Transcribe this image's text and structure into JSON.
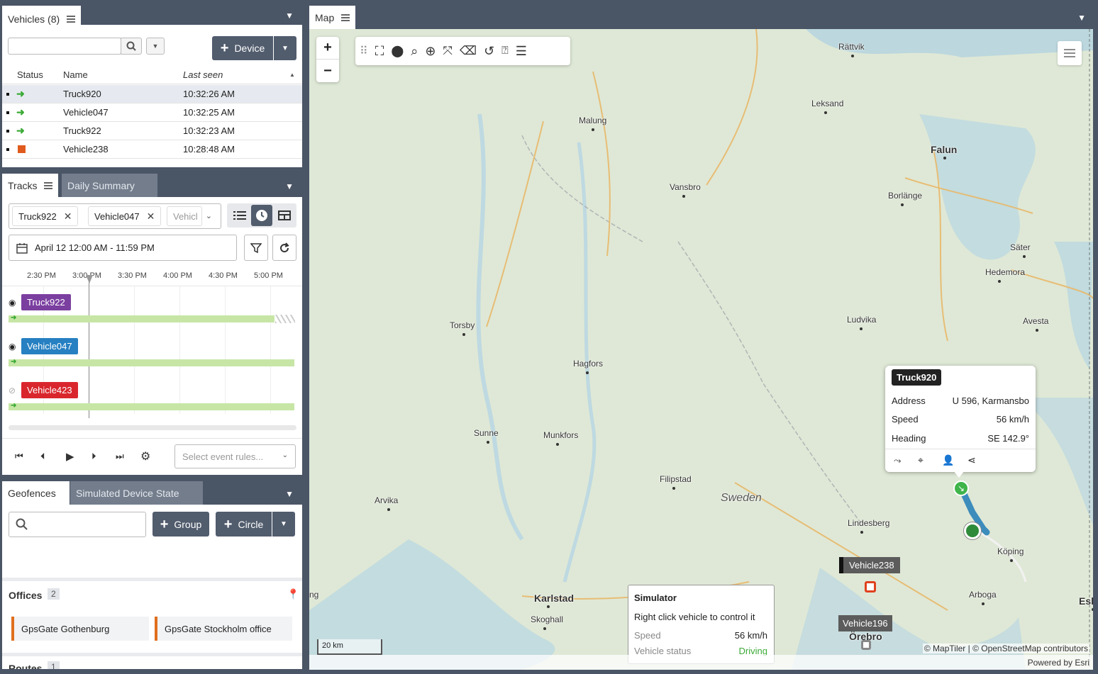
{
  "vehicles_panel": {
    "title": "Vehicles (8)",
    "search_placeholder": "",
    "device_button": "Device",
    "columns": {
      "status": "Status",
      "name": "Name",
      "last_seen": "Last seen"
    },
    "rows": [
      {
        "name": "Truck920",
        "last_seen": "10:32:26 AM",
        "status": "moving"
      },
      {
        "name": "Vehicle047",
        "last_seen": "10:32:25 AM",
        "status": "moving"
      },
      {
        "name": "Truck922",
        "last_seen": "10:32:23 AM",
        "status": "moving"
      },
      {
        "name": "Vehicle238",
        "last_seen": "10:28:48 AM",
        "status": "stopped"
      }
    ]
  },
  "tracks_panel": {
    "tab_tracks": "Tracks",
    "tab_daily_summary": "Daily Summary",
    "chips": [
      "Truck922",
      "Vehicle047",
      "Vehicl"
    ],
    "date_range": "April 12 12:00 AM - 11:59 PM",
    "timeline_ticks": [
      "2:30 PM",
      "3:00 PM",
      "3:30 PM",
      "4:00 PM",
      "4:30 PM",
      "5:00 PM"
    ],
    "tracks": [
      {
        "name": "Truck922",
        "color": "#7b3fa0"
      },
      {
        "name": "Vehicle047",
        "color": "#2680c2"
      },
      {
        "name": "Vehicle423",
        "color": "#d9262c"
      }
    ],
    "event_rules_placeholder": "Select event rules..."
  },
  "geofence_panel": {
    "tab_geofences": "Geofences",
    "tab_simulated": "Simulated Device State",
    "group_button": "Group",
    "circle_button": "Circle",
    "offices_label": "Offices",
    "offices_count": "2",
    "offices": [
      "GpsGate Gothenburg",
      "GpsGate Stockholm office"
    ],
    "routes_label": "Routes",
    "routes_count": "1"
  },
  "map_panel": {
    "tab_label": "Map",
    "zoom_in": "+",
    "zoom_out": "−",
    "scale": "20 km",
    "attribution": "© MapTiler | © OpenStreetMap contributors",
    "powered_by": "Powered by Esri",
    "places": [
      {
        "name": "Rättvik"
      },
      {
        "name": "Leksand"
      },
      {
        "name": "Malung"
      },
      {
        "name": "Falun"
      },
      {
        "name": "Borlänge"
      },
      {
        "name": "Vansbro"
      },
      {
        "name": "Säter"
      },
      {
        "name": "Hedemora"
      },
      {
        "name": "Torsby"
      },
      {
        "name": "Ludvika"
      },
      {
        "name": "Avesta"
      },
      {
        "name": "Hagfors"
      },
      {
        "name": "Sunne"
      },
      {
        "name": "Munkfors"
      },
      {
        "name": "Filipstad"
      },
      {
        "name": "Sweden"
      },
      {
        "name": "Arvika"
      },
      {
        "name": "Lindesberg"
      },
      {
        "name": "Köping"
      },
      {
        "name": "Karlstad"
      },
      {
        "name": "Skoghall"
      },
      {
        "name": "Arboga"
      },
      {
        "name": "Örebro"
      },
      {
        "name": "Esk"
      },
      {
        "name": "ng"
      }
    ],
    "vehicle_labels": [
      "Vehicle238",
      "Vehicle196"
    ],
    "popup": {
      "title": "Truck920",
      "address_label": "Address",
      "address_value": "U 596, Karmansbo",
      "speed_label": "Speed",
      "speed_value": "56 km/h",
      "heading_label": "Heading",
      "heading_value": "SE 142.9°"
    },
    "simulator": {
      "title": "Simulator",
      "hint": "Right click vehicle to control it",
      "speed_label": "Speed",
      "speed_value": "56 km/h",
      "status_label": "Vehicle status",
      "status_value": "Driving"
    }
  },
  "colors": {
    "accent_dark": "#515c6d",
    "moving": "#3aaa35",
    "stopped": "#e05a1e",
    "track_bar": "#c7e6a6"
  }
}
